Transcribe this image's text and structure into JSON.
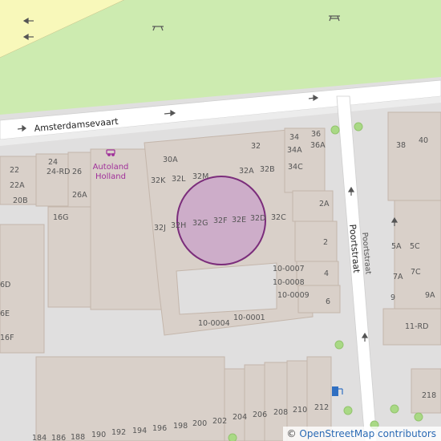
{
  "colors": {
    "background": "#e0dfdf",
    "building": "#d9d0c9",
    "building_outline": "#c4b6ab",
    "park": "#cdebb0",
    "road": "#ffffff",
    "major_road": "#f8f8ba",
    "highlight_fill": "#c8a2c8",
    "highlight_stroke": "#7b2d7b",
    "poi": "#a0309a"
  },
  "map": {
    "streets": {
      "amsterdamsevaart": "Amsterdamsevaart",
      "poortstraat": "Poortstraat",
      "poortstraat_minor": "Poortstraat"
    },
    "poi": {
      "icon": "car-dealer-icon",
      "line1": "Autoland",
      "line2": "Holland"
    },
    "charging_station_icon": "charging-station-icon",
    "picnic_icon": "picnic-table-icon",
    "house_numbers": {
      "n22": "22",
      "n22a": "22A",
      "n20b": "20B",
      "n24": "24",
      "n24rd": "24-RD",
      "n26": "26",
      "n26a": "26A",
      "n16g": "16G",
      "n6d": "6D",
      "n6e": "6E",
      "n16f": "16F",
      "n30a": "30A",
      "n32k": "32K",
      "n32l": "32L",
      "n32m": "32M",
      "n32": "32",
      "n32a": "32A",
      "n32b": "32B",
      "n34": "34",
      "n36": "36",
      "n34a": "34A",
      "n36a": "36A",
      "n34c": "34C",
      "n2a": "2A",
      "n2": "2",
      "n32j": "32J",
      "n32h": "32H",
      "n32g": "32G",
      "n32f": "32F",
      "n32e": "32E",
      "n32d": "32D",
      "n32c": "32C",
      "n10_0007": "10-0007",
      "n10_0008": "10-0008",
      "n10_0009": "10-0009",
      "n4": "4",
      "n6": "6",
      "n10_0004": "10-0004",
      "n10_0001": "10-0001",
      "n38": "38",
      "n40": "40",
      "n5a": "5A",
      "n5c": "5C",
      "n7a": "7A",
      "n7c": "7C",
      "n9": "9",
      "n9a": "9A",
      "n11rd": "11-RD",
      "n218": "218",
      "n184": "184",
      "n186": "186",
      "n188": "188",
      "n190": "190",
      "n192": "192",
      "n194": "194",
      "n196": "196",
      "n198": "198",
      "n200": "200",
      "n202": "202",
      "n204": "204",
      "n206": "206",
      "n208": "208",
      "n210": "210",
      "n212": "212"
    },
    "attribution": {
      "symbol": "©",
      "text": "OpenStreetMap contributors"
    }
  }
}
